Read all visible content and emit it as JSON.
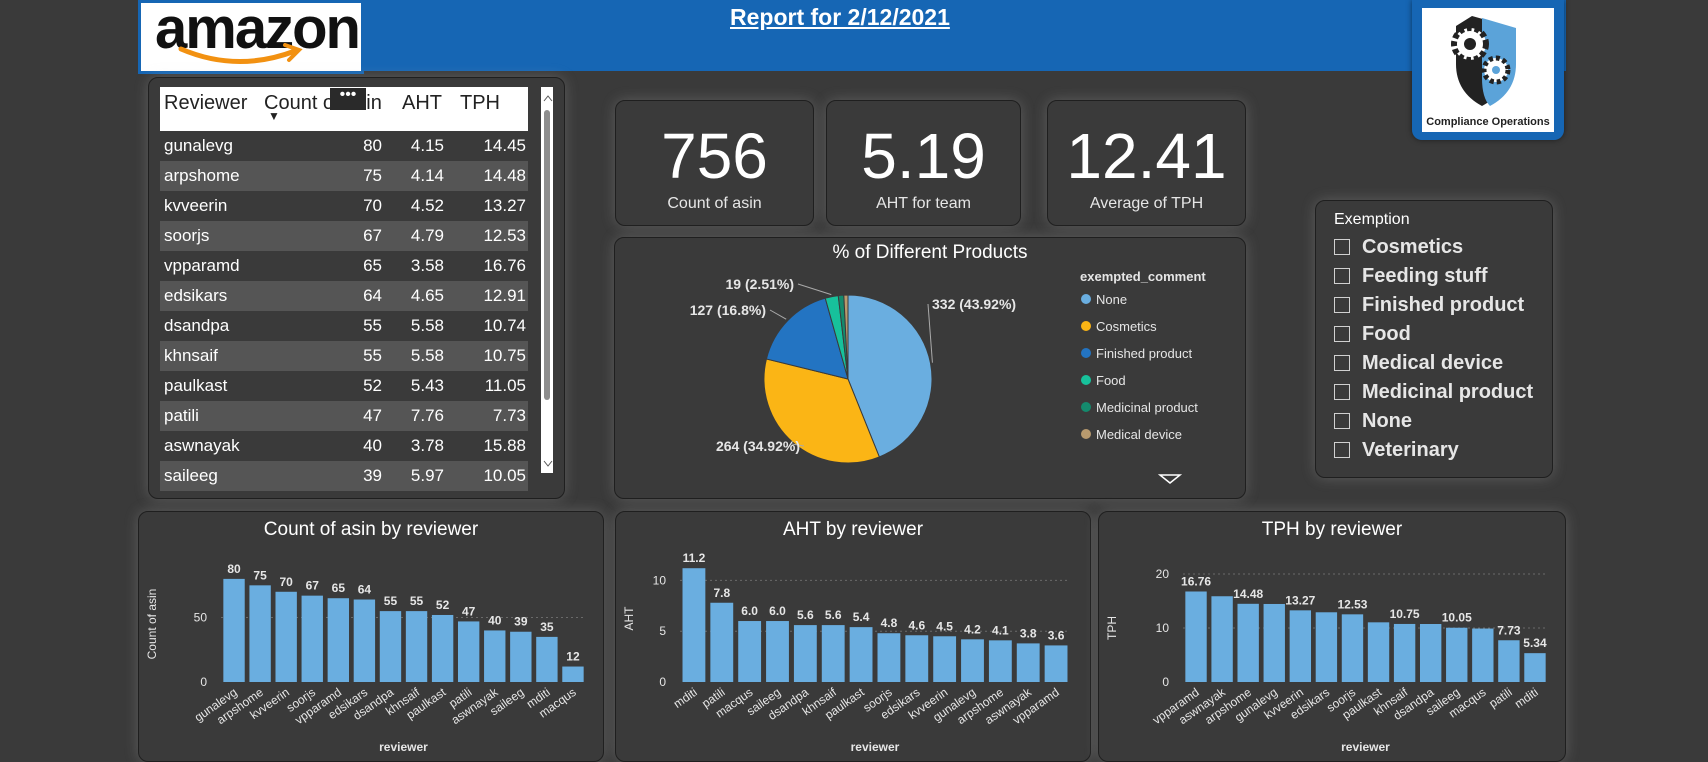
{
  "title": "Report for 2/12/2021",
  "logo_text": "amazon",
  "badge_text": "Compliance Operations",
  "kpis": [
    {
      "value": "756",
      "label": "Count of asin"
    },
    {
      "value": "5.19",
      "label": "AHT for team"
    },
    {
      "value": "12.41",
      "label": "Average of TPH"
    }
  ],
  "table": {
    "headers": [
      "Reviewer",
      "Count of asin",
      "AHT",
      "TPH"
    ],
    "rows": [
      [
        "gunalevg",
        "80",
        "4.15",
        "14.45"
      ],
      [
        "arpshome",
        "75",
        "4.14",
        "14.48"
      ],
      [
        "kvveerin",
        "70",
        "4.52",
        "13.27"
      ],
      [
        "soorjs",
        "67",
        "4.79",
        "12.53"
      ],
      [
        "vpparamd",
        "65",
        "3.58",
        "16.76"
      ],
      [
        "edsikars",
        "64",
        "4.65",
        "12.91"
      ],
      [
        "dsandpa",
        "55",
        "5.58",
        "10.74"
      ],
      [
        "khnsaif",
        "55",
        "5.58",
        "10.75"
      ],
      [
        "paulkast",
        "52",
        "5.43",
        "11.05"
      ],
      [
        "patili",
        "47",
        "7.76",
        "7.73"
      ],
      [
        "aswnayak",
        "40",
        "3.78",
        "15.88"
      ],
      [
        "saileeg",
        "39",
        "5.97",
        "10.05"
      ]
    ],
    "more_options": "•••",
    "sort_indicator": "▼"
  },
  "slicer": {
    "title": "Exemption",
    "items": [
      "Cosmetics",
      "Feeding stuff",
      "Finished product",
      "Food",
      "Medical device",
      "Medicinal product",
      "None",
      "Veterinary"
    ]
  },
  "colors": {
    "bar": "#6aaee0",
    "header": "#1666b4",
    "none": "#6aaee0",
    "cosmetics": "#fbb515",
    "finished": "#2374c2",
    "food": "#17c19b",
    "medicinal": "#148a6d",
    "medical": "#b89a6e"
  },
  "chart_data": [
    {
      "type": "pie",
      "title": "% of Different Products",
      "legend_title": "exempted_comment",
      "legend_position": "right",
      "slices": [
        {
          "name": "None",
          "value": 332,
          "label": "332 (43.92%)",
          "color": "#6aaee0"
        },
        {
          "name": "Cosmetics",
          "value": 264,
          "label": "264 (34.92%)",
          "color": "#fbb515"
        },
        {
          "name": "Finished product",
          "value": 127,
          "label": "127 (16.8%)",
          "color": "#2374c2"
        },
        {
          "name": "Food",
          "value": 19,
          "label": "19 (2.51%)",
          "color": "#17c19b"
        },
        {
          "name": "Medicinal product",
          "value": 8,
          "label": "",
          "color": "#148a6d"
        },
        {
          "name": "Medical device",
          "value": 6,
          "label": "",
          "color": "#b89a6e"
        }
      ],
      "legend": [
        "None",
        "Cosmetics",
        "Finished product",
        "Food",
        "Medicinal product",
        "Medical device"
      ]
    },
    {
      "type": "bar",
      "title": "Count of asin by reviewer",
      "xlabel": "reviewer",
      "ylabel": "Count of asin",
      "ylim": [
        0,
        90
      ],
      "yticks": [
        0,
        50
      ],
      "categories": [
        "gunalevg",
        "arpshome",
        "kvveerin",
        "soorjs",
        "vpparamd",
        "edsikars",
        "dsandpa",
        "khnsaif",
        "paulkast",
        "patili",
        "aswnayak",
        "saileeg",
        "mditi",
        "macqus"
      ],
      "values": [
        80,
        75,
        70,
        67,
        65,
        64,
        55,
        55,
        52,
        47,
        40,
        39,
        35,
        12
      ],
      "labels": [
        "80",
        "75",
        "70",
        "67",
        "65",
        "64",
        "55",
        "55",
        "52",
        "47",
        "40",
        "39",
        "35",
        "12"
      ]
    },
    {
      "type": "bar",
      "title": "AHT by reviewer",
      "xlabel": "reviewer",
      "ylabel": "AHT",
      "ylim": [
        0,
        12.5
      ],
      "yticks": [
        0,
        5,
        10
      ],
      "categories": [
        "mditi",
        "patili",
        "macqus",
        "saileeg",
        "dsandpa",
        "khnsaif",
        "paulkast",
        "soorjs",
        "edsikars",
        "kvveerin",
        "gunalevg",
        "arpshome",
        "aswnayak",
        "vpparamd"
      ],
      "values": [
        11.2,
        7.8,
        6.0,
        6.0,
        5.6,
        5.6,
        5.4,
        4.8,
        4.6,
        4.5,
        4.2,
        4.1,
        3.8,
        3.6
      ],
      "labels": [
        "11.2",
        "7.8",
        "6.0",
        "6.0",
        "5.6",
        "5.6",
        "5.4",
        "4.8",
        "4.6",
        "4.5",
        "4.2",
        "4.1",
        "3.8",
        "3.6"
      ]
    },
    {
      "type": "bar",
      "title": "TPH by reviewer",
      "xlabel": "reviewer",
      "ylabel": "TPH",
      "ylim": [
        0,
        20
      ],
      "yticks": [
        0,
        10,
        20
      ],
      "categories": [
        "vpparamd",
        "aswnayak",
        "arpshome",
        "gunalevg",
        "kvveerin",
        "edsikars",
        "soorjs",
        "paulkast",
        "khnsaif",
        "dsandpa",
        "saileeg",
        "macqus",
        "patili",
        "mditi"
      ],
      "values": [
        16.76,
        15.88,
        14.48,
        14.45,
        13.27,
        12.91,
        12.53,
        11.05,
        10.75,
        10.74,
        10.05,
        9.9,
        7.73,
        5.34
      ],
      "labels": [
        "16.76",
        "",
        "14.48",
        "",
        "13.27",
        "",
        "12.53",
        "",
        "10.75",
        "",
        "10.05",
        "",
        "7.73",
        "5.34"
      ]
    }
  ]
}
